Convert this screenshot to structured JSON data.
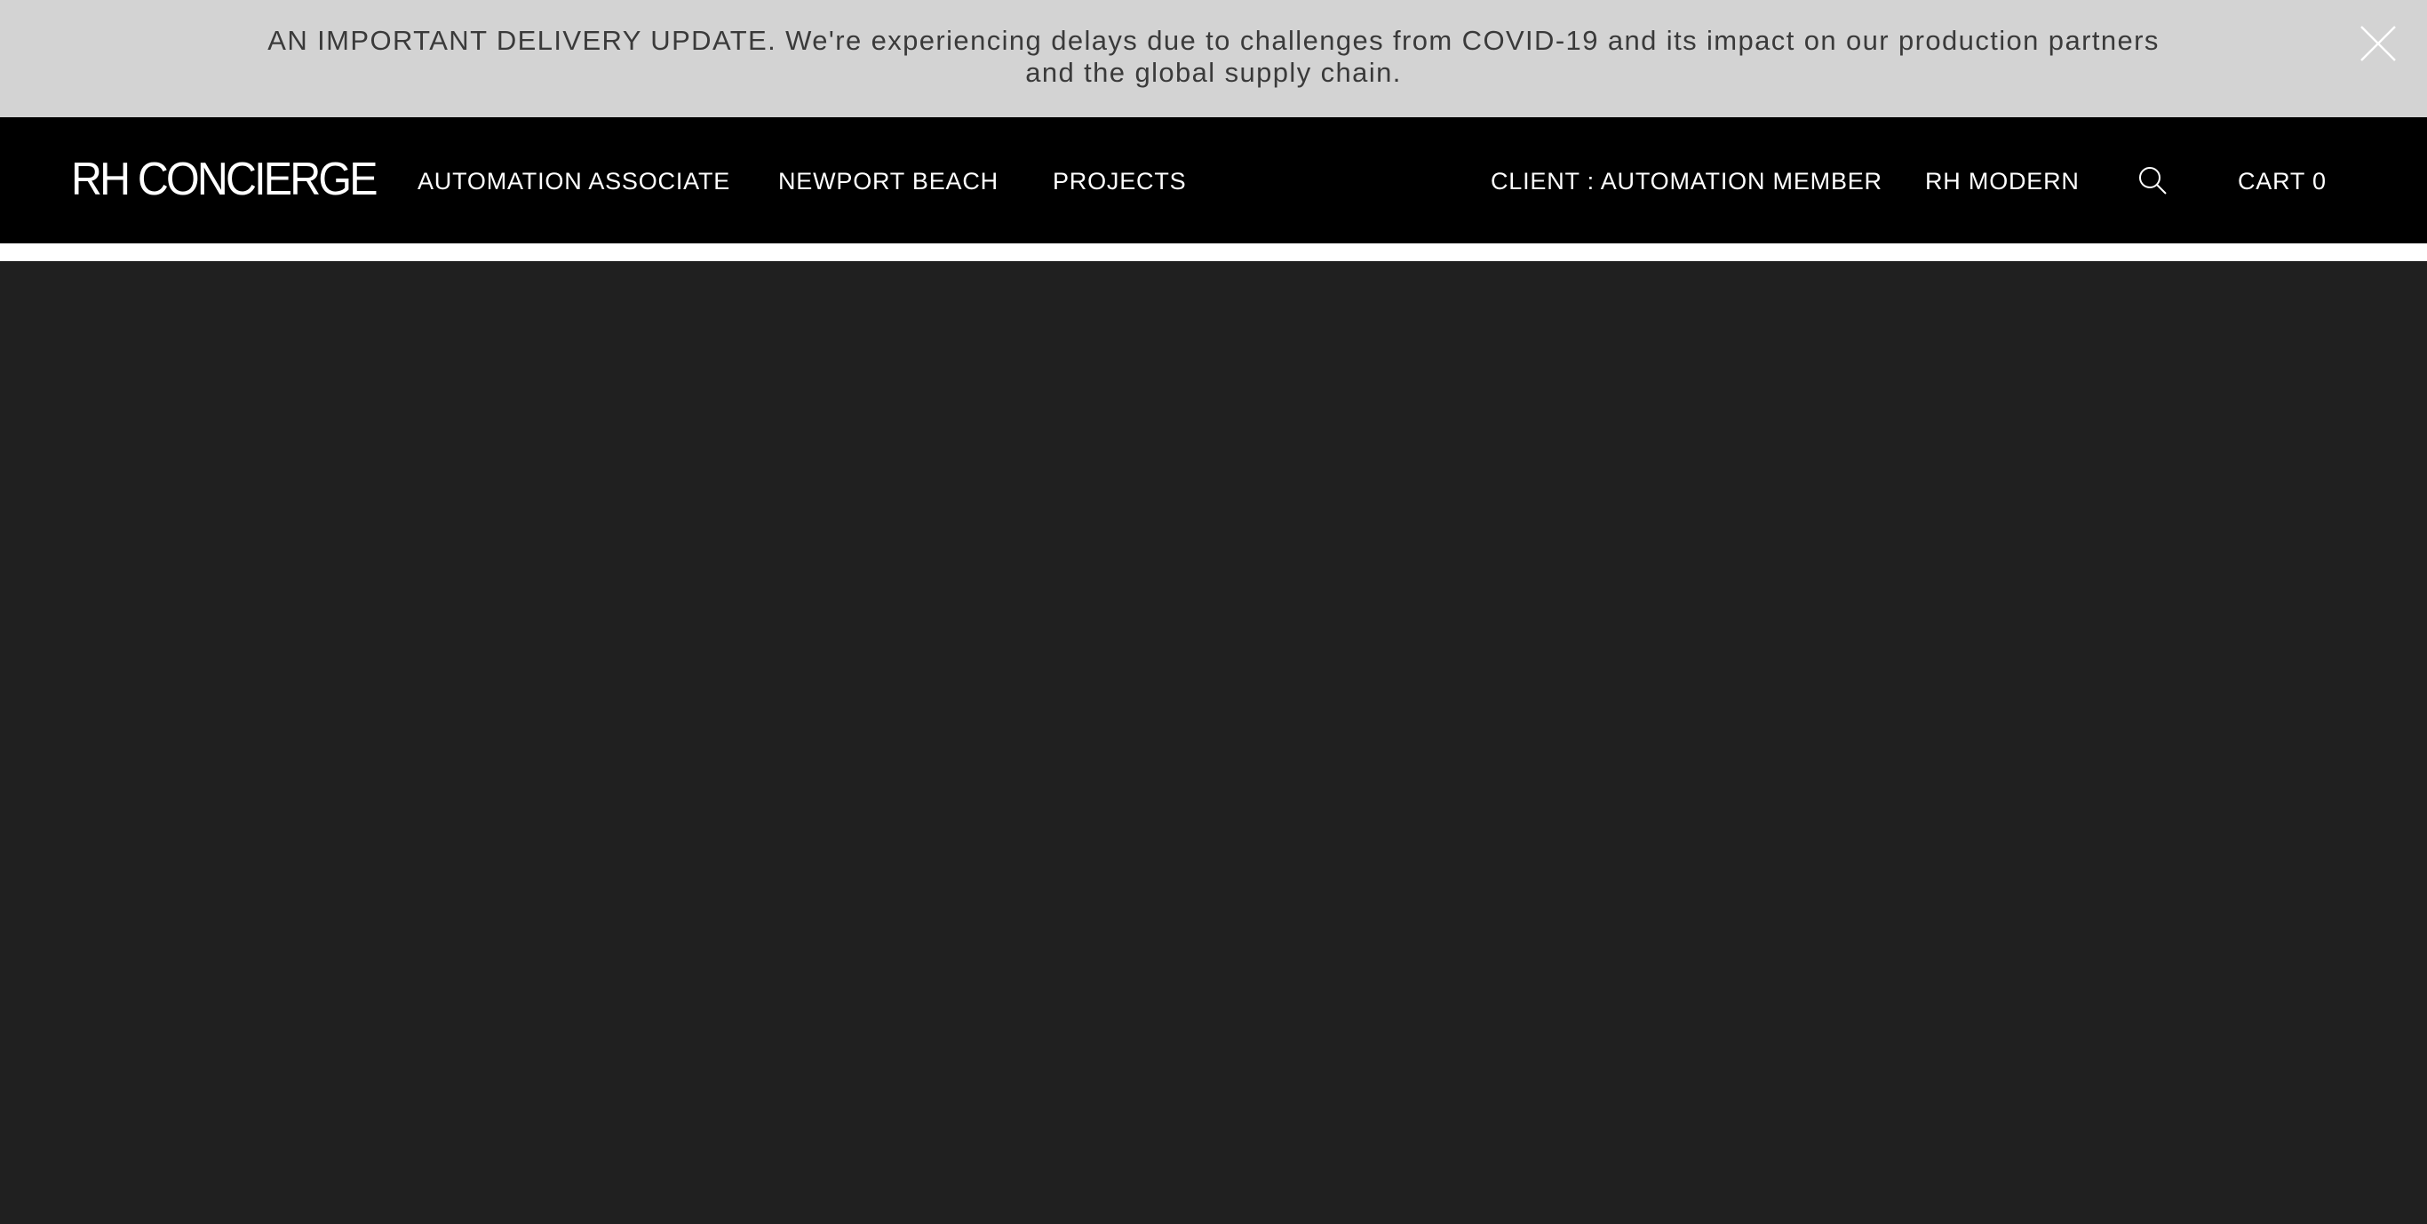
{
  "banner": {
    "message": "AN IMPORTANT DELIVERY UPDATE. We're experiencing delays due to challenges from COVID-19 and its impact on our production partners and the global supply chain.",
    "close_icon": "close-icon"
  },
  "header": {
    "logo_text": "RH CONCIERGE",
    "left_nav": {
      "associate": "AUTOMATION ASSOCIATE",
      "location": "NEWPORT BEACH",
      "projects": "PROJECTS"
    },
    "right_nav": {
      "client": "CLIENT : AUTOMATION MEMBER",
      "brand": "RH MODERN",
      "search_icon": "search-icon",
      "cart": "CART 0"
    }
  },
  "colors": {
    "banner_bg": "#d3d3d3",
    "banner_text": "#3a3a3a",
    "header_bg": "#000000",
    "header_text": "#ffffff",
    "main_bg": "#202020"
  }
}
